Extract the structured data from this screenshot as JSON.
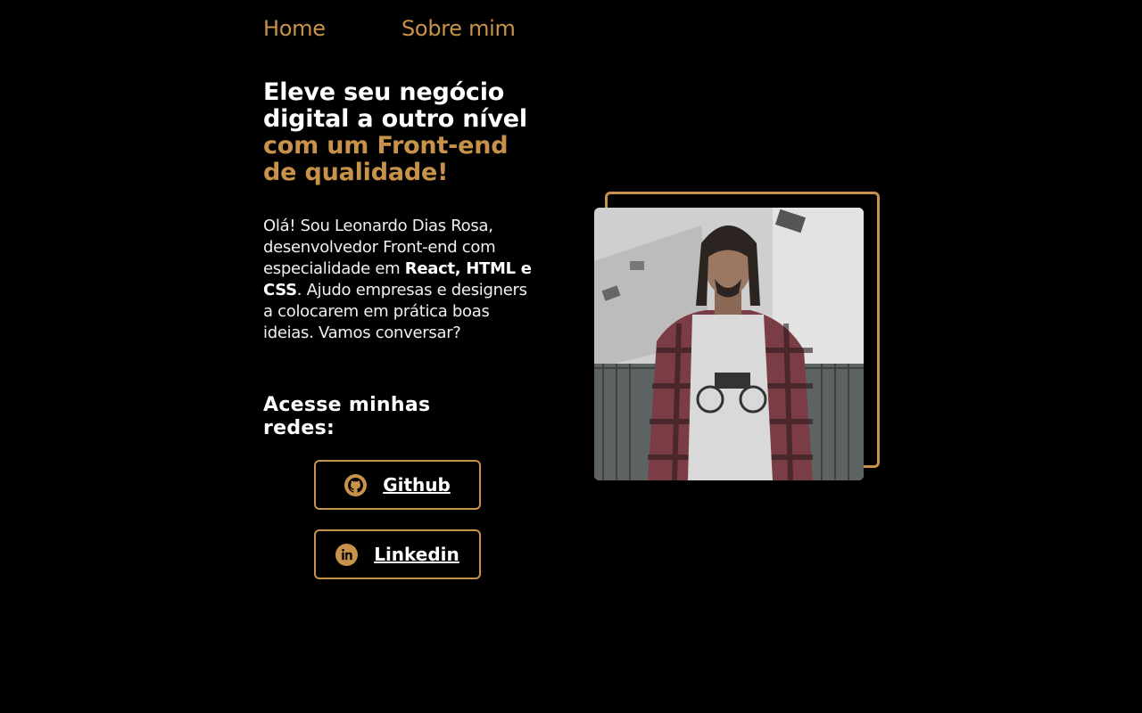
{
  "nav": {
    "home": "Home",
    "about": "Sobre mim"
  },
  "hero": {
    "headline_line1": "Eleve seu negócio",
    "headline_line2": "digital a outro nível",
    "headline_accent1": "com um Front-end",
    "headline_accent2": "de qualidade!",
    "intro_part1": "Olá! Sou Leonardo Dias Rosa, desenvolvedor Front-end com especialidade em ",
    "intro_bold": "React, HTML e CSS",
    "intro_part2": ". Ajudo empresas e designers a colocarem em prática boas ideias. Vamos conversar?"
  },
  "networks": {
    "title": "Acesse minhas redes:",
    "github": {
      "label": "Github",
      "icon": "github-icon"
    },
    "linkedin": {
      "label": "Linkedin",
      "icon": "linkedin-icon"
    }
  },
  "colors": {
    "accent": "#c8924a",
    "background": "#000000",
    "text": "#ffffff"
  }
}
